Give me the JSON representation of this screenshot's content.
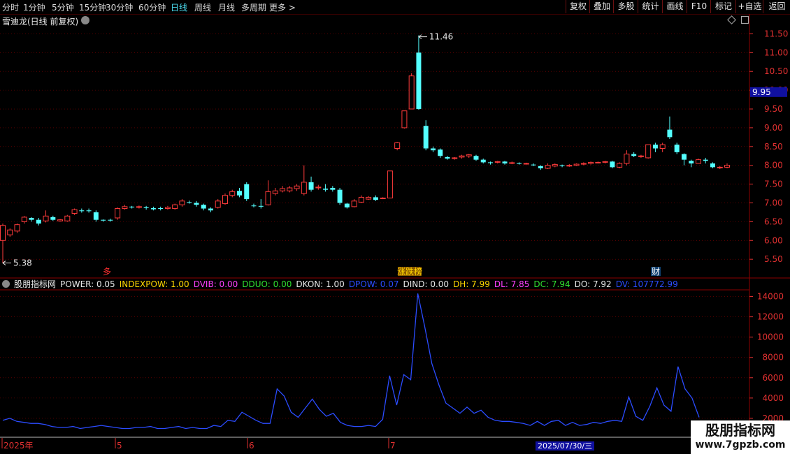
{
  "toolbar": {
    "periods": [
      "分时",
      "1分钟",
      "5分钟",
      "15分钟",
      "30分钟",
      "60分钟",
      "日线",
      "周线",
      "月线",
      "多周期",
      "更多 >"
    ],
    "active_period": "日线",
    "right_buttons": [
      "复权",
      "叠加",
      "多股",
      "统计",
      "画线",
      "F10",
      "标记",
      "+自选",
      "返回"
    ]
  },
  "main": {
    "title": "雪迪龙(日线 前复权)",
    "price_labels": [
      "11.50",
      "11.00",
      "10.50",
      "10.00",
      "9.50",
      "9.00",
      "8.50",
      "8.00",
      "7.50",
      "7.00",
      "6.50",
      "6.00",
      "5.50"
    ],
    "current_price": "9.95",
    "high_annotation": "11.46",
    "low_annotation": "5.38",
    "markers": [
      {
        "text": "多",
        "color": "#ff3030"
      },
      {
        "text": "涨跌榜",
        "color": "#ffd700"
      },
      {
        "text": "财",
        "color": "#ffffff"
      }
    ]
  },
  "indicator": {
    "name": "股朋指标网",
    "values": [
      {
        "text": "POWER: 0.05",
        "color": "#e8e8e8"
      },
      {
        "text": "INDEXPOW: 1.00",
        "color": "#ffd700"
      },
      {
        "text": "DVIB: 0.00",
        "color": "#ff40ff"
      },
      {
        "text": "DDUO: 0.00",
        "color": "#30e030"
      },
      {
        "text": "DKON: 1.00",
        "color": "#e8e8e8"
      },
      {
        "text": "DPOW: 0.07",
        "color": "#2b4cff"
      },
      {
        "text": "DIND: 0.00",
        "color": "#e8e8e8"
      },
      {
        "text": "DH: 7.99",
        "color": "#ffd700"
      },
      {
        "text": "DL: 7.85",
        "color": "#ff40ff"
      },
      {
        "text": "DC: 7.94",
        "color": "#30e030"
      },
      {
        "text": "DO: 7.92",
        "color": "#e8e8e8"
      },
      {
        "text": "DV: 107772.99",
        "color": "#2b4cff"
      }
    ],
    "axis_labels": [
      "14000",
      "12000",
      "10000",
      "8000",
      "6000",
      "4000",
      "2000"
    ]
  },
  "date_axis": {
    "labels": [
      "2025年",
      "5",
      "6",
      "7"
    ],
    "cursor_date": "2025/07/30/三"
  },
  "watermark": {
    "title": "股朋指标网",
    "url": "www.7gpzb.com"
  },
  "colors": {
    "up": "#ff3b3b",
    "down": "#54ffff",
    "grid": "#8b0000",
    "line": "#2b4cff",
    "axis_text": "#e03030"
  },
  "chart_data": {
    "type": "candlestick",
    "price_range": [
      5.28,
      11.75
    ],
    "candles": [
      [
        6.0,
        6.4,
        5.4,
        6.45
      ],
      [
        6.15,
        6.28,
        6.1,
        6.32
      ],
      [
        6.25,
        6.42,
        6.2,
        6.45
      ],
      [
        6.5,
        6.62,
        6.45,
        6.65
      ],
      [
        6.6,
        6.55,
        6.5,
        6.62
      ],
      [
        6.55,
        6.45,
        6.4,
        6.6
      ],
      [
        6.52,
        6.65,
        6.48,
        6.8
      ],
      [
        6.62,
        6.55,
        6.52,
        6.66
      ],
      [
        6.52,
        6.55,
        6.5,
        6.57
      ],
      [
        6.52,
        6.65,
        6.5,
        6.68
      ],
      [
        6.72,
        6.82,
        6.68,
        6.85
      ],
      [
        6.8,
        6.78,
        6.74,
        6.85
      ],
      [
        6.8,
        6.78,
        6.74,
        6.85
      ],
      [
        6.75,
        6.55,
        6.5,
        6.8
      ],
      [
        6.55,
        6.53,
        6.5,
        6.56
      ],
      [
        6.55,
        6.53,
        6.5,
        6.58
      ],
      [
        6.6,
        6.85,
        6.55,
        6.88
      ],
      [
        6.85,
        6.9,
        6.82,
        6.95
      ],
      [
        6.9,
        6.88,
        6.85,
        6.92
      ],
      [
        6.88,
        6.9,
        6.85,
        6.93
      ],
      [
        6.88,
        6.86,
        6.82,
        6.92
      ],
      [
        6.86,
        6.83,
        6.8,
        6.9
      ],
      [
        6.86,
        6.84,
        6.8,
        6.9
      ],
      [
        6.85,
        6.88,
        6.82,
        6.92
      ],
      [
        6.85,
        6.95,
        6.82,
        6.98
      ],
      [
        6.95,
        7.05,
        6.9,
        7.1
      ],
      [
        7.02,
        7.0,
        6.98,
        7.06
      ],
      [
        7.0,
        6.95,
        6.9,
        7.05
      ],
      [
        6.95,
        6.85,
        6.8,
        6.98
      ],
      [
        6.85,
        6.8,
        6.75,
        6.88
      ],
      [
        6.88,
        7.05,
        6.85,
        7.1
      ],
      [
        6.98,
        7.2,
        6.95,
        7.25
      ],
      [
        7.2,
        7.3,
        7.15,
        7.35
      ],
      [
        7.32,
        7.2,
        7.15,
        7.4
      ],
      [
        7.5,
        7.1,
        7.05,
        7.55
      ],
      [
        6.93,
        6.92,
        6.88,
        6.98
      ],
      [
        6.92,
        6.9,
        6.85,
        7.1
      ],
      [
        6.95,
        7.3,
        6.93,
        7.6
      ],
      [
        7.25,
        7.32,
        7.2,
        7.4
      ],
      [
        7.32,
        7.38,
        7.28,
        7.45
      ],
      [
        7.32,
        7.4,
        7.28,
        7.45
      ],
      [
        7.38,
        7.45,
        7.32,
        7.5
      ],
      [
        7.25,
        7.55,
        7.2,
        8.0
      ],
      [
        7.55,
        7.35,
        7.3,
        7.7
      ],
      [
        7.4,
        7.42,
        7.35,
        7.48
      ],
      [
        7.38,
        7.35,
        7.3,
        7.5
      ],
      [
        7.4,
        7.35,
        7.3,
        7.45
      ],
      [
        7.35,
        7.0,
        6.95,
        7.4
      ],
      [
        6.98,
        6.88,
        6.85,
        7.0
      ],
      [
        6.9,
        7.05,
        6.88,
        7.1
      ],
      [
        7.02,
        7.15,
        7.0,
        7.2
      ],
      [
        7.1,
        7.15,
        7.08,
        7.18
      ],
      [
        7.15,
        7.08,
        7.05,
        7.2
      ],
      [
        7.12,
        7.13,
        7.1,
        7.15
      ],
      [
        7.13,
        7.85,
        7.12,
        7.85
      ],
      [
        8.45,
        8.6,
        8.4,
        8.62
      ],
      [
        9.0,
        9.45,
        8.98,
        9.45
      ],
      [
        9.5,
        10.38,
        9.5,
        10.45
      ],
      [
        11.0,
        9.5,
        9.48,
        11.46
      ],
      [
        9.05,
        8.45,
        8.4,
        9.2
      ],
      [
        8.45,
        8.4,
        8.35,
        8.5
      ],
      [
        8.42,
        8.25,
        8.2,
        8.45
      ],
      [
        8.22,
        8.18,
        8.15,
        8.25
      ],
      [
        8.18,
        8.2,
        8.15,
        8.22
      ],
      [
        8.22,
        8.25,
        8.18,
        8.28
      ],
      [
        8.25,
        8.28,
        8.2,
        8.3
      ],
      [
        8.25,
        8.15,
        8.12,
        8.28
      ],
      [
        8.15,
        8.08,
        8.05,
        8.18
      ],
      [
        8.08,
        8.06,
        8.02,
        8.1
      ],
      [
        8.08,
        8.1,
        8.05,
        8.12
      ],
      [
        8.1,
        8.05,
        8.02,
        8.12
      ],
      [
        8.06,
        8.07,
        8.03,
        8.1
      ],
      [
        8.06,
        8.04,
        8.02,
        8.08
      ],
      [
        8.04,
        8.05,
        8.02,
        8.07
      ],
      [
        8.02,
        8.0,
        7.98,
        8.05
      ],
      [
        7.98,
        7.92,
        7.88,
        8.0
      ],
      [
        7.92,
        8.0,
        7.9,
        8.05
      ],
      [
        7.98,
        8.02,
        7.95,
        8.05
      ],
      [
        8.0,
        7.98,
        7.95,
        8.02
      ],
      [
        7.98,
        8.0,
        7.96,
        8.03
      ],
      [
        8.0,
        8.03,
        7.98,
        8.05
      ],
      [
        8.03,
        8.05,
        8.0,
        8.08
      ],
      [
        8.05,
        8.08,
        8.02,
        8.1
      ],
      [
        8.07,
        8.08,
        8.05,
        8.1
      ],
      [
        8.08,
        8.1,
        8.05,
        8.12
      ],
      [
        8.1,
        7.95,
        7.92,
        8.12
      ],
      [
        7.95,
        8.05,
        7.92,
        8.08
      ],
      [
        8.05,
        8.3,
        8.0,
        8.4
      ],
      [
        8.3,
        8.25,
        8.22,
        8.35
      ],
      [
        8.25,
        8.25,
        8.2,
        8.28
      ],
      [
        8.2,
        8.55,
        8.18,
        8.55
      ],
      [
        8.55,
        8.45,
        8.35,
        8.6
      ],
      [
        8.45,
        8.55,
        8.35,
        8.6
      ],
      [
        8.95,
        8.75,
        8.7,
        9.3
      ],
      [
        8.55,
        8.35,
        8.3,
        8.6
      ],
      [
        8.3,
        8.15,
        8.0,
        8.32
      ],
      [
        8.12,
        8.05,
        7.95,
        8.15
      ],
      [
        8.05,
        8.15,
        8.05,
        8.18
      ],
      [
        8.15,
        8.12,
        8.05,
        8.2
      ],
      [
        8.05,
        7.95,
        7.92,
        8.08
      ],
      [
        7.95,
        7.95,
        7.9,
        7.98
      ],
      [
        7.95,
        8.0,
        7.92,
        8.05
      ]
    ],
    "volume_range": [
      0,
      15000
    ],
    "volume": [
      1800,
      2000,
      1700,
      1600,
      1500,
      1500,
      1400,
      1200,
      1100,
      1100,
      1200,
      1000,
      1100,
      1200,
      1300,
      1200,
      1100,
      1000,
      1000,
      1100,
      1100,
      1200,
      1000,
      1000,
      1100,
      1200,
      1000,
      1100,
      1000,
      1000,
      1300,
      1200,
      1800,
      1700,
      2600,
      2200,
      1800,
      1500,
      1500,
      4900,
      4200,
      2600,
      2100,
      3000,
      3900,
      2900,
      2200,
      2500,
      1600,
      1300,
      1200,
      1200,
      1300,
      1200,
      1900,
      6200,
      3300,
      6300,
      5800,
      14300,
      11000,
      7400,
      5300,
      3500,
      3000,
      2500,
      3100,
      2500,
      2800,
      2100,
      1800,
      1700,
      1700,
      1600,
      1500,
      1300,
      1700,
      1300,
      1700,
      1800,
      1300,
      1600,
      1300,
      1400,
      1600,
      1500,
      1700,
      1800,
      1700,
      4100,
      2200,
      1800,
      3200,
      5000,
      3300,
      2700,
      7100,
      4900,
      4000,
      2100
    ]
  }
}
